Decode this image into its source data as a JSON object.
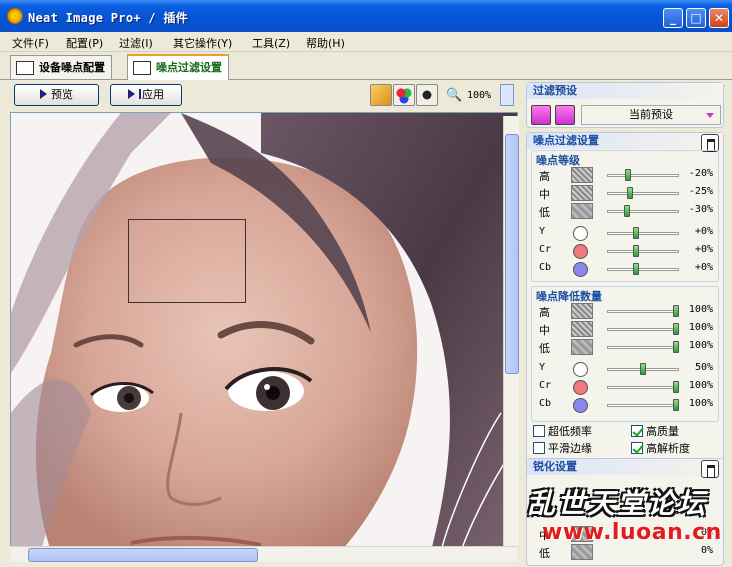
{
  "window": {
    "title": "Neat Image Pro+ / 插件",
    "minimize": "_",
    "maximize": "□",
    "close": "✕"
  },
  "menu": [
    "文件(F)",
    "配置(P)",
    "过滤(I)",
    "其它操作(Y)",
    "工具(Z)",
    "帮助(H)"
  ],
  "tabs": [
    {
      "label": "设备噪点配置",
      "active": false
    },
    {
      "label": "噪点过滤设置",
      "active": true
    }
  ],
  "toolbar": {
    "preview_label": "预览",
    "apply_label": "应用",
    "zoom": "100%"
  },
  "panel": {
    "preset_title": "过滤预设",
    "preset_value": "当前预设",
    "filter_settings_title": "噪点过滤设置",
    "noise_level_title": "噪点等级",
    "noise_level_rows": [
      {
        "label": "高",
        "value": "-20%",
        "level": 0.28
      },
      {
        "label": "中",
        "value": "-25%",
        "level": 0.3
      },
      {
        "label": "低",
        "value": "-30%",
        "level": 0.25
      }
    ],
    "noise_level_channels": [
      {
        "label": "Y",
        "value": "+0%",
        "level": 0.4,
        "color": "#ffffff"
      },
      {
        "label": "Cr",
        "value": "+0%",
        "level": 0.4,
        "color": "#f07a7a"
      },
      {
        "label": "Cb",
        "value": "+0%",
        "level": 0.4,
        "color": "#8888ee"
      }
    ],
    "reduction_title": "噪点降低数量",
    "reduction_rows": [
      {
        "label": "高",
        "value": "100%",
        "level": 1.0
      },
      {
        "label": "中",
        "value": "100%",
        "level": 1.0
      },
      {
        "label": "低",
        "value": "100%",
        "level": 1.0
      }
    ],
    "reduction_channels": [
      {
        "label": "Y",
        "value": "50%",
        "level": 0.5,
        "color": "#ffffff"
      },
      {
        "label": "Cr",
        "value": "100%",
        "level": 1.0,
        "color": "#f07a7a"
      },
      {
        "label": "Cb",
        "value": "100%",
        "level": 1.0,
        "color": "#8888ee"
      }
    ],
    "options": [
      {
        "label": "超低频率",
        "checked": false
      },
      {
        "label": "高质量",
        "checked": true
      },
      {
        "label": "平滑边缘",
        "checked": false
      },
      {
        "label": "高解析度",
        "checked": true
      }
    ],
    "sharpen_title": "锐化设置",
    "sharpen_rows": [
      {
        "label": "中",
        "value": "0%"
      },
      {
        "label": "低",
        "value": "0%"
      }
    ]
  },
  "watermark": {
    "line1": "乱世天堂论坛",
    "line2": "www.luoan.cn"
  }
}
